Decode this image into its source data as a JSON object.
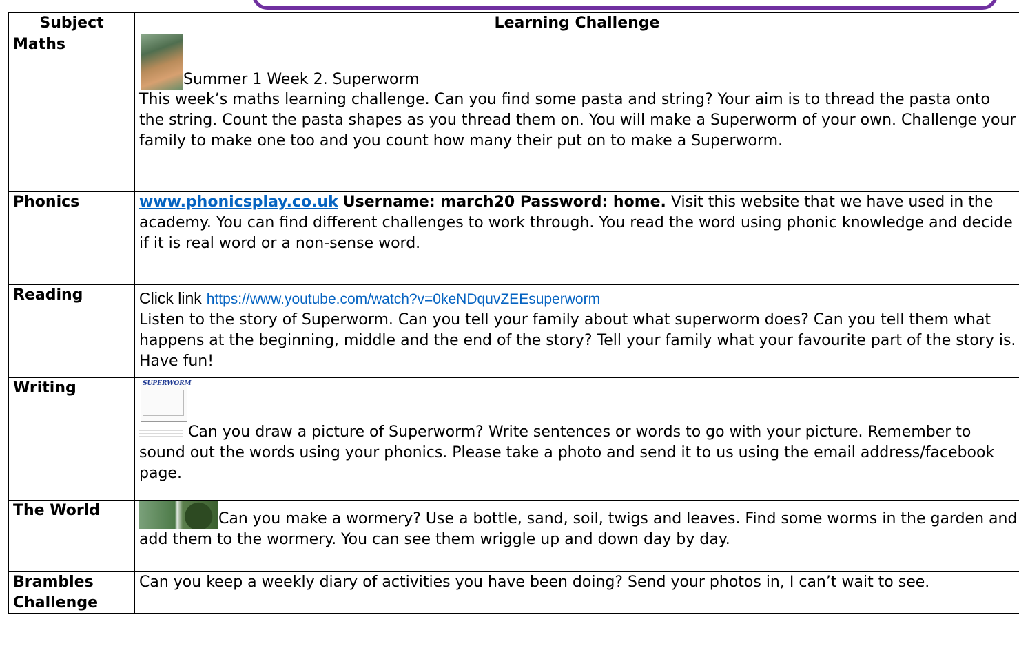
{
  "table": {
    "header_subject": "Subject",
    "header_challenge": "Learning Challenge"
  },
  "maths": {
    "subject": "Maths",
    "title": "Summer 1 Week 2. Superworm",
    "body": "This week’s maths learning challenge. Can you find some pasta and string? Your aim is to thread the pasta onto the string. Count the pasta shapes as you thread them on. You will make a Superworm of your own. Challenge your family to make one too and you count how many their put on to make a Superworm."
  },
  "phonics": {
    "subject": "Phonics",
    "link": "www.phonicsplay.co.uk",
    "credentials": "Username: march20 Password: home.",
    "body": "Visit this website that we have used in the academy. You can find different challenges to work through. You read the word using phonic knowledge and decide if it is real word or a non-sense word."
  },
  "reading": {
    "subject": "Reading",
    "click_label": "Click link",
    "link": "https://www.youtube.com/watch?v=0keNDquvZEEsuperworm",
    "body": "Listen to the story of Superworm. Can you tell your family about what superworm does? Can you tell them what happens at the beginning, middle and the end of the story? Tell your family what your favourite part of the story is. Have fun!"
  },
  "writing": {
    "subject": "Writing",
    "worksheet_title": "SUPERWORM",
    "body": "Can you draw a picture of Superworm? Write sentences or words to go with your picture. Remember to sound out the words using your phonics. Please take a photo and send it to us using the email address/facebook page."
  },
  "world": {
    "subject": "The World",
    "body": "Can you make a wormery? Use a bottle, sand, soil, twigs and leaves. Find some worms in the garden and add them to the wormery. You can see them wriggle up and down day by day."
  },
  "brambles": {
    "subject_line1": "Brambles",
    "subject_line2": "Challenge",
    "body": "Can you keep a weekly diary of activities you have been doing? Send your photos in, I can’t wait to see."
  }
}
